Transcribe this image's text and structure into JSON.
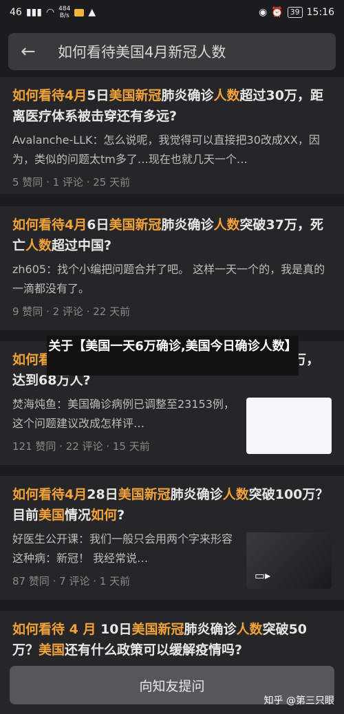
{
  "status_bar": {
    "network": "46",
    "speed_value": "484",
    "speed_unit": "B/s",
    "battery": "39",
    "time": "15:16"
  },
  "search": {
    "query": "如何看待美国4月新冠人数"
  },
  "results": [
    {
      "title": "如何看待4月5日美国新冠肺炎确诊人数超过30万，距离医疗体系被击穿还有多远?",
      "excerpt": "Avalanche-LLK：怎么说呢，我觉得可以直接把30改成XX，因为，类似的问题太tm多了…现在也就几天一个…",
      "meta": "5 赞同 · 1 评论 · 25 天前"
    },
    {
      "title": "如何看待4月6日美国新冠肺炎确诊人数突破37万，死亡人数超过中国?",
      "excerpt": "zh605：找个小编把问题合并了吧。 这样一天一个的，我是真的一滴都没有了。",
      "meta": "9 赞同 · 2 评论 · 22 天前"
    },
    {
      "title": "如何看待4月13日美国新冠肺炎确诊人数日增12万，达到68万人?",
      "excerpt": "焚海炖鱼：美国确诊病例已调整至23153例，这个问题建议改成怎样评…",
      "meta": "121 赞同 · 22 评论 · 15 天前"
    },
    {
      "title": "如何看待4月28日美国新冠肺炎确诊人数突破100万？目前美国情况如何?",
      "excerpt": "好医生公开课：我们一般只会用两个字来形容这种病：新冠！ 我经常说…",
      "meta": "87 赞同 · 7 评论 · 1 天前"
    },
    {
      "title": "如何看待 4 月 10日美国新冠肺炎确诊人数突破50万？美国还有什么政策可以缓解疫情吗?"
    }
  ],
  "overlay": {
    "text": "关于【美国一天6万确诊,美国今日确诊人数】"
  },
  "ask_button": "向知友提问",
  "watermark": "知乎 @第三只眼",
  "colors": {
    "highlight": "#f2a23a",
    "background": "#1c1c1e",
    "card": "#262628"
  },
  "icons": [
    "back-arrow-icon",
    "wifi-icon",
    "signal-icon",
    "eye-icon",
    "alarm-icon",
    "video-icon"
  ]
}
